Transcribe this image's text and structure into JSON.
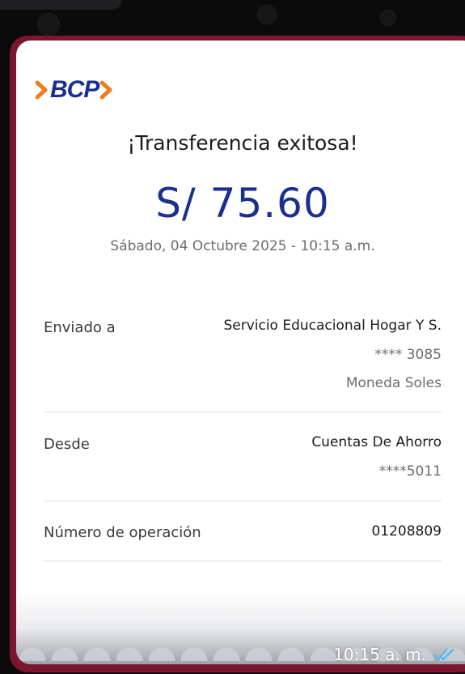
{
  "receipt": {
    "logo_text": "BCP",
    "title": "¡Transferencia exitosa!",
    "amount": "S/ 75.60",
    "datetime": "Sábado, 04 Octubre 2025 - 10:15 a.m."
  },
  "sent_to": {
    "label": "Enviado a",
    "name": "Servicio Educacional Hogar Y S.",
    "account": "**** 3085",
    "currency": "Moneda Soles"
  },
  "from": {
    "label": "Desde",
    "account_type": "Cuentas De Ahorro",
    "account": "****5011"
  },
  "operation": {
    "label": "Número de operación",
    "number": "01208809"
  },
  "message": {
    "time": "10:15 a. m.",
    "status_icon": "double-check-read-icon"
  },
  "colors": {
    "brand_blue": "#1a2f8f",
    "brand_orange": "#f07c1b",
    "frame": "#7a1630",
    "read_ticks": "#53bdeb"
  }
}
